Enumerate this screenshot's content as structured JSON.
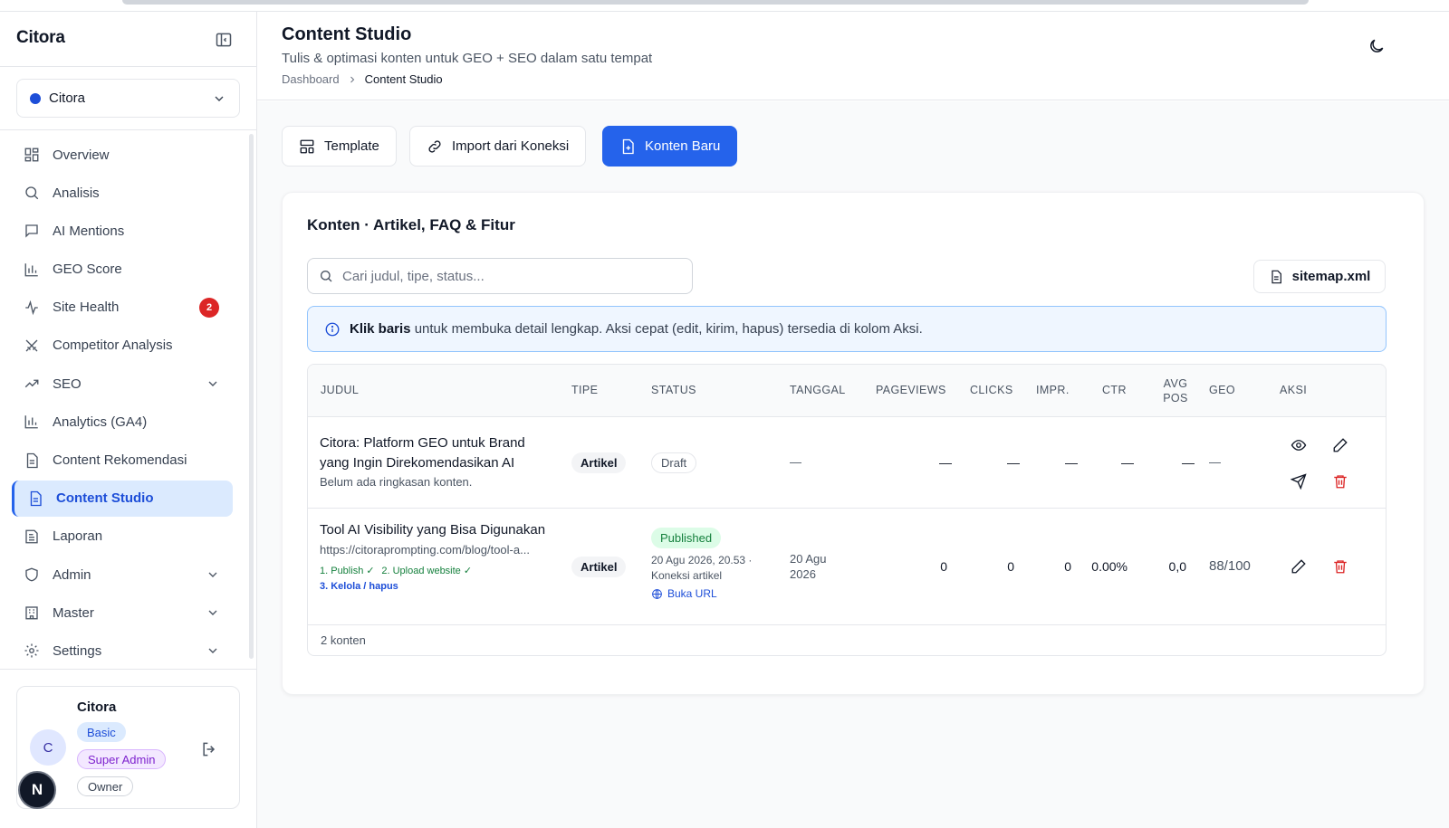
{
  "app": {
    "brand": "Citora"
  },
  "workspace": {
    "name": "Citora"
  },
  "sidebar": {
    "items": [
      {
        "label": "Overview"
      },
      {
        "label": "Analisis"
      },
      {
        "label": "AI Mentions"
      },
      {
        "label": "GEO Score"
      },
      {
        "label": "Site Health",
        "badge": "2"
      },
      {
        "label": "Competitor Analysis"
      },
      {
        "label": "SEO"
      },
      {
        "label": "Analytics (GA4)"
      },
      {
        "label": "Content Rekomendasi"
      },
      {
        "label": "Content Studio"
      },
      {
        "label": "Laporan"
      },
      {
        "label": "Admin"
      },
      {
        "label": "Master"
      },
      {
        "label": "Settings"
      }
    ]
  },
  "user": {
    "initial": "C",
    "name": "Citora",
    "roles": [
      "Basic",
      "Super Admin",
      "Owner"
    ]
  },
  "fab": {
    "label": "N"
  },
  "header": {
    "title": "Content Studio",
    "subtitle": "Tulis & optimasi konten untuk GEO + SEO dalam satu tempat",
    "breadcrumb": [
      "Dashboard",
      "Content Studio"
    ]
  },
  "toolbar": {
    "template": "Template",
    "import": "Import dari Koneksi",
    "new": "Konten Baru"
  },
  "content": {
    "title": "Konten · Artikel, FAQ & Fitur",
    "search_placeholder": "Cari judul, tipe, status...",
    "sitemap": "sitemap.xml",
    "info_bold": "Klik baris",
    "info_rest": "untuk membuka detail lengkap. Aksi cepat (edit, kirim, hapus) tersedia di kolom Aksi.",
    "columns": [
      "Judul",
      "Tipe",
      "Status",
      "Tanggal",
      "Pageviews",
      "Clicks",
      "Impr.",
      "CTR",
      "Avg Pos",
      "GEO",
      "Aksi"
    ],
    "rows": [
      {
        "title": "Citora: Platform GEO untuk Brand yang Ingin Direkomendasikan AI",
        "summary": "Belum ada ringkasan konten.",
        "type": "Artikel",
        "status": "Draft",
        "date": "—",
        "pageviews": "—",
        "clicks": "—",
        "impr": "—",
        "ctr": "—",
        "avgpos": "—",
        "geo": "—"
      },
      {
        "title": "Tool AI Visibility yang Bisa Digunakan",
        "url": "https://citoraprompting.com/blog/tool-a...",
        "step1": "1. Publish ✓",
        "step2": "2. Upload website ✓",
        "step3": "3. Kelola / hapus",
        "type": "Artikel",
        "status": "Published",
        "status_meta": "20 Agu 2026, 20.53 · Koneksi artikel",
        "open_url": "Buka URL",
        "date": "20 Agu 2026",
        "pageviews": "0",
        "clicks": "0",
        "impr": "0",
        "ctr": "0.00%",
        "avgpos": "0,0",
        "geo": "88/100"
      }
    ],
    "footer": "2 konten"
  }
}
